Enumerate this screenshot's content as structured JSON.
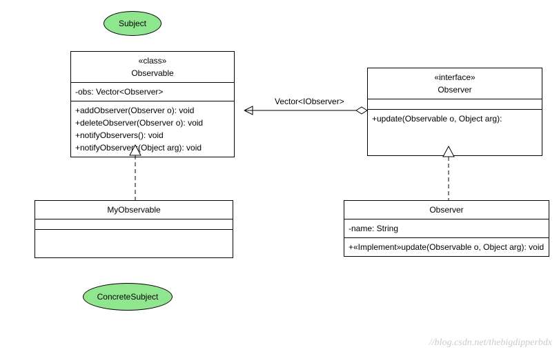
{
  "notes": {
    "subject": "Subject",
    "concreteSubject": "ConcreteSubject"
  },
  "observable": {
    "stereotype": "«class»",
    "name": "Observable",
    "attributes": [
      "-obs: Vector<Observer>"
    ],
    "operations": [
      "+addObserver(Observer o): void",
      "+deleteObserver(Observer o): void",
      "+notifyObservers(): void",
      "+notifyObservers(Object arg): void"
    ]
  },
  "observerInterface": {
    "stereotype": "«interface»",
    "name": "Observer",
    "operations": [
      "+update(Observable o, Object arg):"
    ]
  },
  "myObservable": {
    "name": "MyObservable"
  },
  "observerConcrete": {
    "name": "Observer",
    "attributes": [
      "-name: String"
    ],
    "operations": [
      "+«Implement»update(Observable o, Object arg): void"
    ]
  },
  "association": {
    "label": "Vector<IObserver>"
  },
  "watermark": "//blog.csdn.net/thebigdipperbdx"
}
